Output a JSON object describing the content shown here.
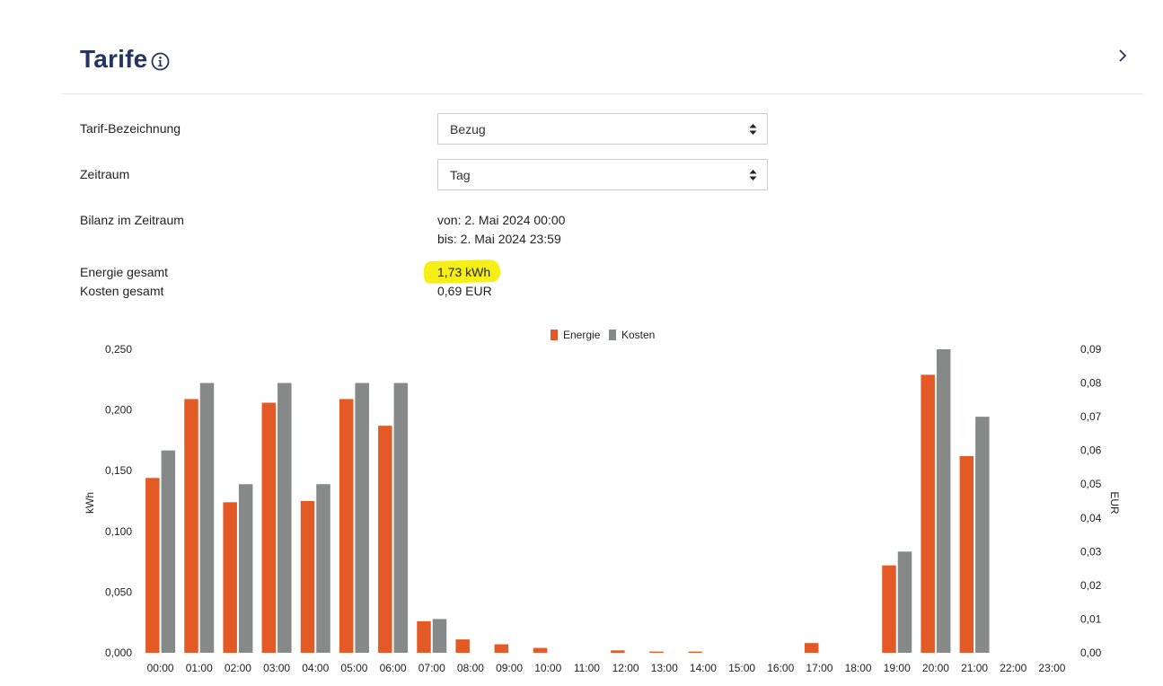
{
  "header": {
    "title": "Tarife"
  },
  "form": {
    "tarif_label": "Tarif-Bezeichnung",
    "tarif_value": "Bezug",
    "zeitraum_label": "Zeitraum",
    "zeitraum_value": "Tag",
    "bilanz_label": "Bilanz im Zeitraum",
    "von": "von: 2. Mai 2024 00:00",
    "bis": "bis: 2. Mai 2024 23:59",
    "energie_label": "Energie gesamt",
    "energie_value": "1,73 kWh",
    "kosten_label": "Kosten gesamt",
    "kosten_value": "0,69 EUR"
  },
  "colors": {
    "title": "#24365f",
    "energie": "#e35a27",
    "kosten": "#858987",
    "highlight": "#f6ef17"
  },
  "chart_data": {
    "type": "bar",
    "categories": [
      "00:00",
      "01:00",
      "02:00",
      "03:00",
      "04:00",
      "05:00",
      "06:00",
      "07:00",
      "08:00",
      "09:00",
      "10:00",
      "11:00",
      "12:00",
      "13:00",
      "14:00",
      "15:00",
      "16:00",
      "17:00",
      "18:00",
      "19:00",
      "20:00",
      "21:00",
      "22:00",
      "23:00"
    ],
    "series": [
      {
        "name": "Energie",
        "axis": "left",
        "values": [
          0.144,
          0.209,
          0.124,
          0.206,
          0.125,
          0.209,
          0.187,
          0.026,
          0.011,
          0.007,
          0.004,
          0,
          0.002,
          0.001,
          0.001,
          0,
          0,
          0.008,
          0,
          0.072,
          0.229,
          0.162,
          0,
          0
        ]
      },
      {
        "name": "Kosten",
        "axis": "right",
        "values": [
          0.06,
          0.08,
          0.05,
          0.08,
          0.05,
          0.08,
          0.08,
          0.01,
          0,
          0,
          0,
          0,
          0,
          0,
          0,
          0,
          0,
          0,
          0,
          0.03,
          0.09,
          0.07,
          0,
          0
        ]
      }
    ],
    "ylabel": "kWh",
    "y2label": "EUR",
    "ylim": [
      0,
      0.25
    ],
    "y2lim": [
      0,
      0.09
    ],
    "yticks": [
      "0,000",
      "0,050",
      "0,100",
      "0,150",
      "0,200",
      "0,250"
    ],
    "y2ticks": [
      "0,00",
      "0,01",
      "0,02",
      "0,03",
      "0,04",
      "0,05",
      "0,06",
      "0,07",
      "0,08",
      "0,09"
    ],
    "legend": "top-center",
    "grid": false
  }
}
